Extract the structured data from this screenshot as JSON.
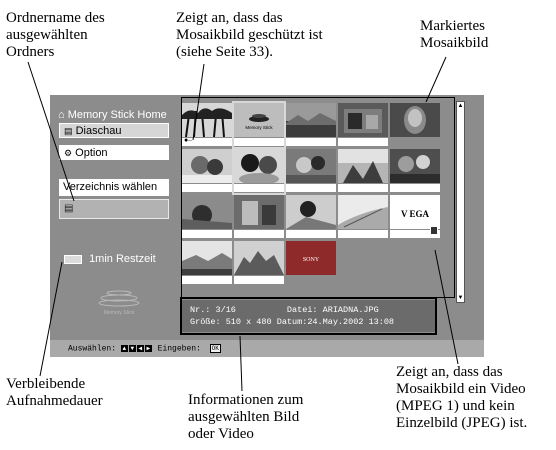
{
  "annotations": {
    "folder_name": [
      "Ordnername des",
      "ausgewählten",
      "Ordners"
    ],
    "protected": [
      "Zeigt an, dass das",
      "Mosaikbild geschützt ist",
      "(siehe Seite 33)."
    ],
    "marked": [
      "Markiertes",
      "Mosaikbild"
    ],
    "remaining_time": [
      "Verbleibende",
      "Aufnahmedauer"
    ],
    "info": [
      "Informationen zum",
      "ausgewählten Bild",
      "oder Video"
    ],
    "video": [
      "Zeigt an, dass das",
      "Mosaikbild ein Video",
      "(MPEG 1) und kein",
      "Einzelbild (JPEG) ist."
    ]
  },
  "sidebar": {
    "title": "Memory Stick Home",
    "diaschau": "Diaschau",
    "option": "Option",
    "verzeichnis": "Verzeichnis wählen",
    "remaining": "1min Restzeit",
    "logo_text": "Memory Stick"
  },
  "thumbnails": {
    "memory_stick_label": "Memory Stick",
    "vega_label": "V EGA",
    "sony_label": "SONY"
  },
  "info": {
    "line1": "Nr.: 3/16          Datei: ARIADNA.JPG",
    "line2": "Größe: 510 x 480 Datum:24.May.2002 13:08"
  },
  "bottombar": {
    "prefix": "Auswählen:",
    "suffix": "Eingeben:",
    "ok": "OK"
  }
}
